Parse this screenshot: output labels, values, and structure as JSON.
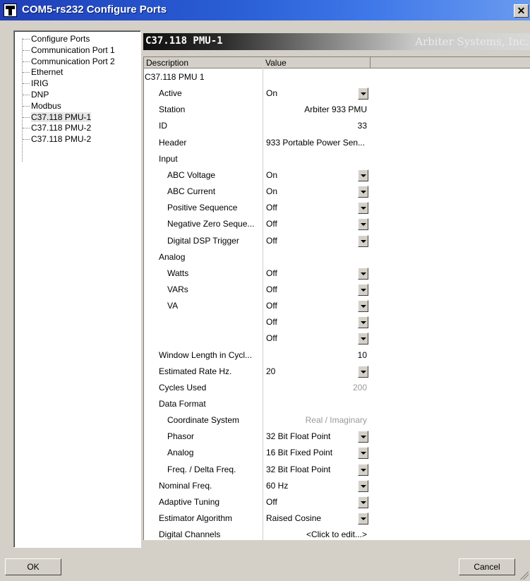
{
  "window": {
    "title": "COM5-rs232 Configure Ports",
    "close_label": "✕"
  },
  "tree": {
    "items": [
      {
        "label": "Configure Ports"
      },
      {
        "label": "Communication Port 1"
      },
      {
        "label": "Communication Port 2"
      },
      {
        "label": "Ethernet"
      },
      {
        "label": "IRIG"
      },
      {
        "label": "DNP"
      },
      {
        "label": "Modbus"
      },
      {
        "label": "C37.118 PMU-1"
      },
      {
        "label": "C37.118 PMU-2"
      },
      {
        "label": "C37.118 PMU-2"
      }
    ],
    "selected": "C37.118 PMU-1"
  },
  "banner": {
    "title": "C37.118 PMU-1",
    "company": "Arbiter Systems, Inc."
  },
  "grid": {
    "columns": [
      "Description",
      "Value"
    ],
    "rows": [
      {
        "label": "C37.118 PMU 1",
        "indent": 0,
        "value": ""
      },
      {
        "label": "Active",
        "indent": 1,
        "value": "On",
        "dropdown": true
      },
      {
        "label": "Station",
        "indent": 1,
        "value": "Arbiter 933 PMU",
        "align": "right"
      },
      {
        "label": "ID",
        "indent": 1,
        "value": "33",
        "align": "right"
      },
      {
        "label": "Header",
        "indent": 1,
        "value": "933 Portable Power Sen..."
      },
      {
        "label": "Input",
        "indent": 1,
        "value": ""
      },
      {
        "label": "ABC Voltage",
        "indent": 2,
        "value": "On",
        "dropdown": true
      },
      {
        "label": "ABC Current",
        "indent": 2,
        "value": "On",
        "dropdown": true
      },
      {
        "label": "Positive Sequence",
        "indent": 2,
        "value": "Off",
        "dropdown": true
      },
      {
        "label": "Negative Zero Seque...",
        "indent": 2,
        "value": "Off",
        "dropdown": true
      },
      {
        "label": "Digital DSP Trigger",
        "indent": 2,
        "value": "Off",
        "dropdown": true
      },
      {
        "label": "Analog",
        "indent": 1,
        "value": ""
      },
      {
        "label": "Watts",
        "indent": 2,
        "value": "Off",
        "dropdown": true
      },
      {
        "label": "VARs",
        "indent": 2,
        "value": "Off",
        "dropdown": true
      },
      {
        "label": "VA",
        "indent": 2,
        "value": "Off",
        "dropdown": true
      },
      {
        "label": "",
        "indent": 2,
        "value": "Off",
        "dropdown": true
      },
      {
        "label": "",
        "indent": 2,
        "value": "Off",
        "dropdown": true
      },
      {
        "label": "Window Length in Cycl...",
        "indent": 1,
        "value": "10",
        "align": "right"
      },
      {
        "label": "Estimated Rate Hz.",
        "indent": 1,
        "value": "20",
        "dropdown": true
      },
      {
        "label": "Cycles Used",
        "indent": 1,
        "value": "200",
        "align": "right",
        "disabled": true
      },
      {
        "label": "Data Format",
        "indent": 1,
        "value": ""
      },
      {
        "label": "Coordinate System",
        "indent": 2,
        "value": "Real / Imaginary",
        "align": "right",
        "disabled": true
      },
      {
        "label": "Phasor",
        "indent": 2,
        "value": "32 Bit Float Point",
        "dropdown": true
      },
      {
        "label": "Analog",
        "indent": 2,
        "value": "16 Bit Fixed Point",
        "dropdown": true
      },
      {
        "label": "Freq. / Delta Freq.",
        "indent": 2,
        "value": "32 Bit Float Point",
        "dropdown": true
      },
      {
        "label": "Nominal Freq.",
        "indent": 1,
        "value": "60 Hz",
        "dropdown": true
      },
      {
        "label": "Adaptive Tuning",
        "indent": 1,
        "value": "Off",
        "dropdown": true
      },
      {
        "label": "Estimator Algorithm",
        "indent": 1,
        "value": "Raised Cosine",
        "dropdown": true
      },
      {
        "label": "Digital Channels",
        "indent": 1,
        "value": "<Click to edit...>",
        "align": "right"
      }
    ]
  },
  "buttons": {
    "ok": "OK",
    "cancel": "Cancel"
  }
}
